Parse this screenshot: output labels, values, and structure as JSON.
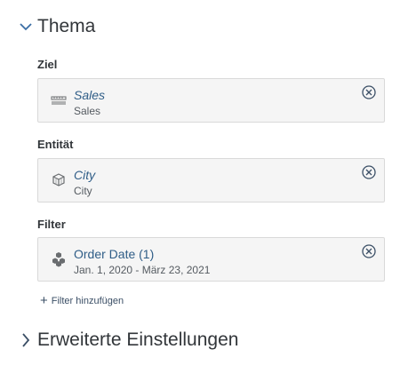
{
  "sections": {
    "thema": {
      "title": "Thema",
      "expanded": true
    },
    "advanced": {
      "title": "Erweiterte Einstellungen",
      "expanded": false
    }
  },
  "fields": {
    "ziel": {
      "label": "Ziel",
      "value": "Sales",
      "sub": "Sales",
      "icon": "measure-icon"
    },
    "entitat": {
      "label": "Entität",
      "value": "City",
      "sub": "City",
      "icon": "dimension-cube-icon"
    },
    "filter": {
      "label": "Filter",
      "value": "Order Date (1)",
      "sub": "Jan. 1, 2020 - März 23, 2021",
      "icon": "filter-cubes-icon"
    }
  },
  "add_filter": {
    "label": "Filter hinzufügen"
  },
  "colors": {
    "link": "#2f5d87",
    "card_bg": "#f5f5f5",
    "border": "#d9d9d9",
    "text": "#32363a"
  }
}
